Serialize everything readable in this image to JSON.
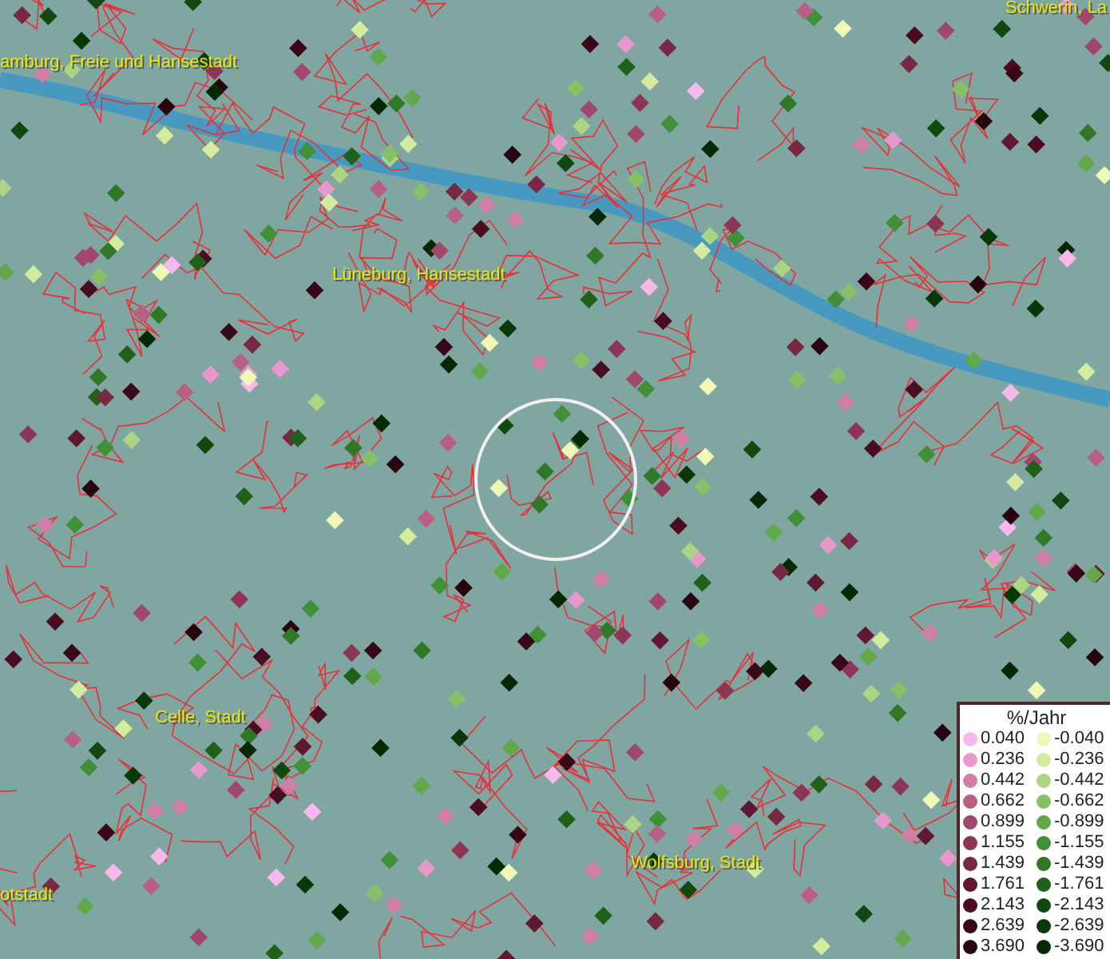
{
  "map": {
    "place_labels": [
      "amburg, Freie und Hansestadt",
      "Schwerin, La",
      "Lüneburg, Hansestadt",
      "Celle, Stadt",
      "otstadt",
      "Wolfsburg, Stadt"
    ]
  },
  "legend": {
    "title": "%/Jahr",
    "entries": [
      {
        "value": "0.040",
        "color": "#f8b8ec"
      },
      {
        "value": "-0.040",
        "color": "#f0f8b8"
      },
      {
        "value": "0.236",
        "color": "#e898cc"
      },
      {
        "value": "-0.236",
        "color": "#d4eca0"
      },
      {
        "value": "0.442",
        "color": "#d07ea4"
      },
      {
        "value": "-0.442",
        "color": "#acd484"
      },
      {
        "value": "0.662",
        "color": "#b86084"
      },
      {
        "value": "-0.662",
        "color": "#88c068"
      },
      {
        "value": "0.899",
        "color": "#a0486c"
      },
      {
        "value": "-0.899",
        "color": "#60a848"
      },
      {
        "value": "1.155",
        "color": "#8c3554"
      },
      {
        "value": "-1.155",
        "color": "#409038"
      },
      {
        "value": "1.439",
        "color": "#782842"
      },
      {
        "value": "-1.439",
        "color": "#307828"
      },
      {
        "value": "1.761",
        "color": "#601830"
      },
      {
        "value": "-1.761",
        "color": "#206018"
      },
      {
        "value": "2.143",
        "color": "#4a0c20"
      },
      {
        "value": "-2.143",
        "color": "#104810"
      },
      {
        "value": "2.639",
        "color": "#380818"
      },
      {
        "value": "-2.639",
        "color": "#083808"
      },
      {
        "value": "3.690",
        "color": "#280410"
      },
      {
        "value": "-3.690",
        "color": "#042804"
      }
    ]
  }
}
